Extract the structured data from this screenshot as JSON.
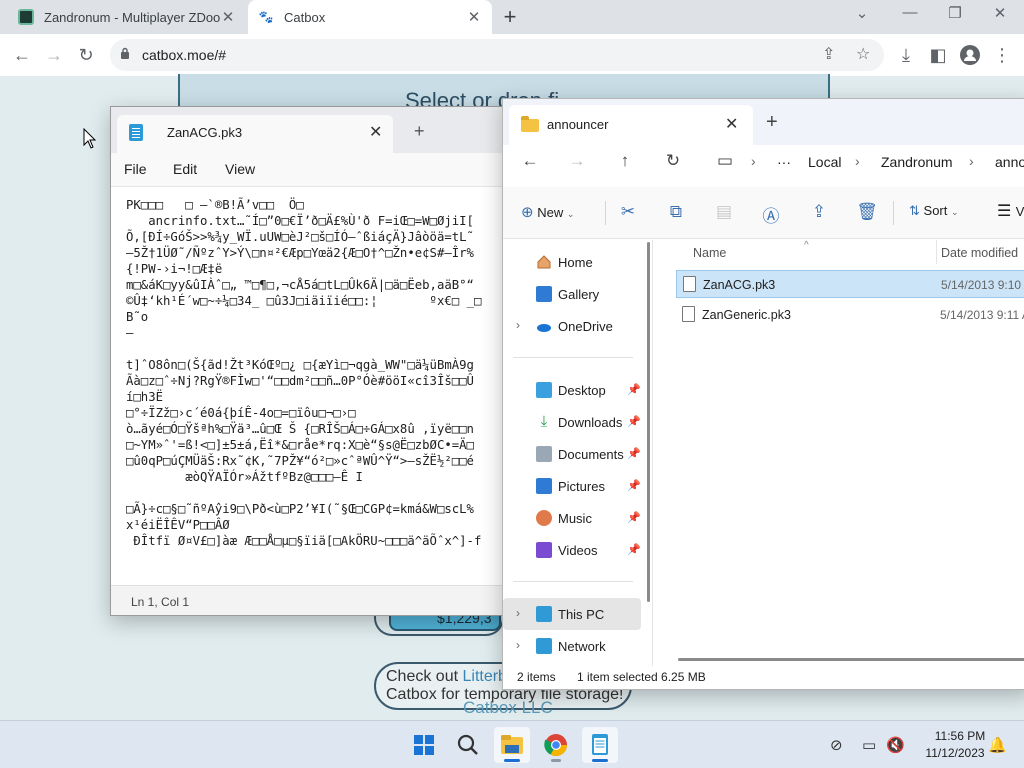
{
  "browser": {
    "tabs": [
      {
        "title": "Zandronum - Multiplayer ZDoom",
        "active": false
      },
      {
        "title": "Catbox",
        "active": true
      }
    ],
    "url": "catbox.moe/#"
  },
  "page": {
    "banner_text": "Select or drop fi",
    "amount_text": "$1,229,3",
    "promo_line1_prefix": "Check out ",
    "promo_line1_link": "Litterb",
    "promo_line2": "Catbox for temporary file storage!",
    "footer": "Catbox LLC"
  },
  "notepad": {
    "tab_title": "ZanACG.pk3",
    "menu": [
      "File",
      "Edit",
      "View"
    ],
    "content": "PK□□□   □ –`®B!Ã’v□□  Ö□\n   ancrinfo.txt…˜Í□”0□€Ï’ð□Ä£%Ù'ð F=iŒ□=W□ØjiI[\nÕ,[ÐÍ÷GóŠ>>%¾y_WÏ.uUW□èJ²□š□ÍÓ—ˆßiáçÄ}Jâòöä=tL˜\n–5Ž†1ÜØ˜/ÑºzˆY>Ý\\□n¤²€Æp□Yœä2{Æ□O†^□Žn•e¢S#–Îr%\n{!PW-›i¬!□Æ‡ë\nm□&áK□yy&ûIÀˆ□„ ™□¶□,¬cÅ5á□tL□Ûk6Ä|□ä□Ëeb,aäB°“\n©Û‡‘kh¹É´w□~÷¼□34_ □û3J□iäiïié□□:¦       ºx€□ _□\nB˜o\n–\n\nt]ˆO8ôn□(Š{ãd!Žt³KóŒº□¿ □{æYì□¬qgà_WW\"□ä¼üBmÀ9g\nÃà□z□ˆ÷Nj?RgŸ®FÌw□'“□□dm²□□ñ…0P°Óè#ööI«cî3Îš□□Û\ní□h3Ë\n□°÷ÏZž□›c´é0á{þíÊ-4o□=□ïôu□¬□›□\nò…ãyé□Ó□Ÿšªh%□Ÿä³…û□Œ Š {□RÎŠ□Á□÷GÁ□x8û ,ïyë□□n\n□~YM»ˆ'=ß!<□]±5±á,Ëî*&□råe*rq:X□è“§s@Ë□zbØC•=Ä□\n□û0qP□úÇMÜäŠ:Rx˜¢K,˜7PŽ¥“ó²□»cˆªWÛ^Ÿ“>–sŽË½²□□é\n        æòQŸAÏÓr»ÁžtfºBz@□□□–Ê I\n\n□Ã}÷c□§□˜ñºAŷi9□\\Pð<ù□P2’¥I(˜§Œ□CGP¢=kmá&W□scL%\nx¹éiËÎÊV“P□□ÂØ\n ÐÎtfï Ø¤V£□]àæ Æ□□Å□µ□§ïiä[□AkÖRU~□□□ä^äÕˆx^]-f",
    "status": "Ln 1, Col 1"
  },
  "explorer": {
    "tab_title": "announcer",
    "breadcrumb": [
      "···",
      "Local",
      "Zandronum",
      "anno"
    ],
    "commands": {
      "new": "New",
      "sort": "Sort",
      "view": "V"
    },
    "nav": [
      {
        "label": "Home",
        "icon": "home-icon",
        "pinned": false
      },
      {
        "label": "Gallery",
        "icon": "gallery-icon",
        "pinned": false
      },
      {
        "label": "OneDrive",
        "icon": "onedrive-icon",
        "pinned": false
      },
      {
        "label": "Desktop",
        "icon": "desktop-icon",
        "pinned": true
      },
      {
        "label": "Downloads",
        "icon": "downloads-icon",
        "pinned": true
      },
      {
        "label": "Documents",
        "icon": "documents-icon",
        "pinned": true
      },
      {
        "label": "Pictures",
        "icon": "pictures-icon",
        "pinned": true
      },
      {
        "label": "Music",
        "icon": "music-icon",
        "pinned": true
      },
      {
        "label": "Videos",
        "icon": "videos-icon",
        "pinned": true
      },
      {
        "label": "This PC",
        "icon": "this-pc-icon",
        "pinned": false
      },
      {
        "label": "Network",
        "icon": "network-icon",
        "pinned": false
      }
    ],
    "columns": [
      "Name",
      "Date modified"
    ],
    "files": [
      {
        "name": "ZanACG.pk3",
        "date": "5/14/2013 9:10 A",
        "selected": true
      },
      {
        "name": "ZanGeneric.pk3",
        "date": "5/14/2013 9:11 A",
        "selected": false
      }
    ],
    "status": {
      "count": "2 items",
      "selection": "1 item selected  6.25 MB"
    }
  },
  "taskbar": {
    "time": "11:56 PM",
    "date": "11/12/2023"
  },
  "colors": {
    "accent": "#1a6fd0",
    "selection": "#cce4f7",
    "page_bg": "#e0ecee"
  }
}
